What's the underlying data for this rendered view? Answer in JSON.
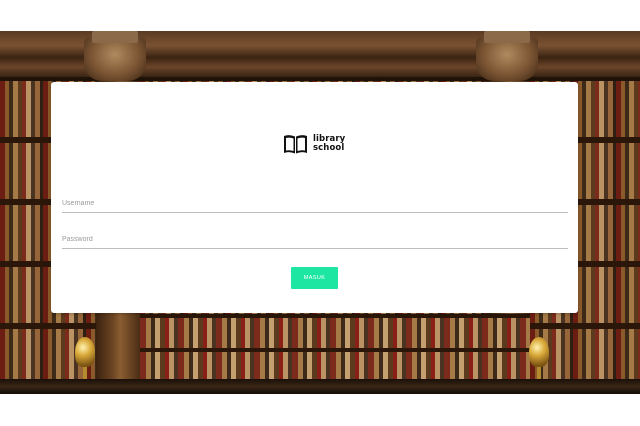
{
  "brand": {
    "line1": "library",
    "line2": "school",
    "logo_icon": "open-book-icon"
  },
  "form": {
    "username_placeholder": "Username",
    "password_placeholder": "Password",
    "submit_label": "MASUK"
  },
  "colors": {
    "accent": "#1de6a3",
    "card": "#ffffff",
    "field_underline": "#bdbdbd"
  }
}
